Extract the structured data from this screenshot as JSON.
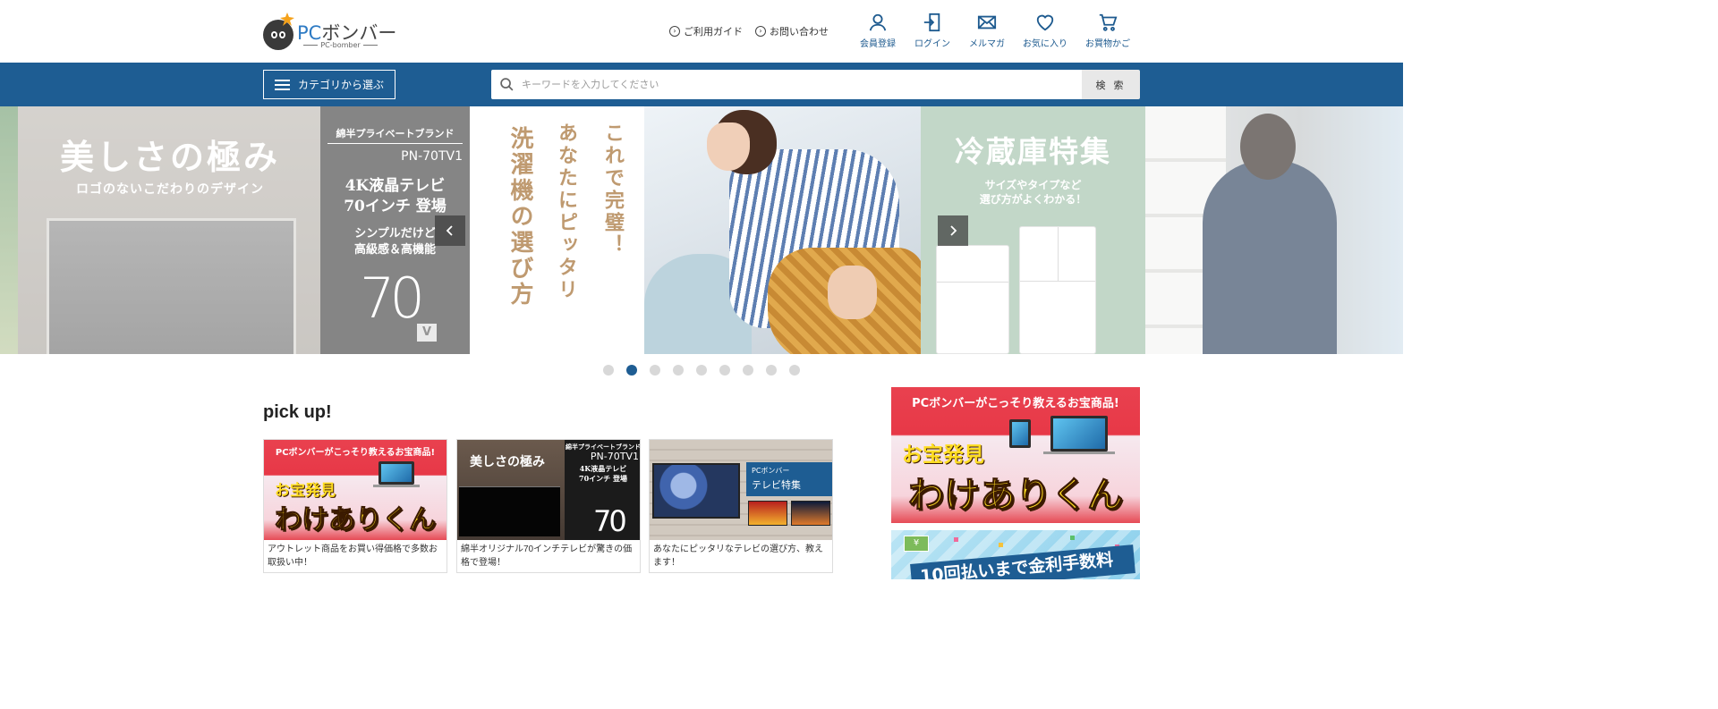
{
  "header": {
    "logo": {
      "main_prefix": "PC",
      "main_rest": "ボンバー",
      "sub": "PC-bomber"
    },
    "guide_link": "ご利用ガイド",
    "contact_link": "お問い合わせ",
    "utility": [
      {
        "label": "会員登録",
        "icon": "user-icon"
      },
      {
        "label": "ログイン",
        "icon": "login-icon"
      },
      {
        "label": "メルマガ",
        "icon": "mail-icon"
      },
      {
        "label": "お気に入り",
        "icon": "heart-icon"
      },
      {
        "label": "お買物かご",
        "icon": "cart-icon"
      }
    ]
  },
  "navbar": {
    "category_button": "カテゴリから選ぶ",
    "search_placeholder": "キーワードを入力してください",
    "search_value": "",
    "search_button": "検 索"
  },
  "carousel": {
    "tv_slide": {
      "title": "美しさの極み",
      "subtitle": "ロゴのないこだわりのデザイン",
      "brand": "綿半プライベートブランド",
      "model": "PN-70TV1",
      "spec_line1": "4K液晶テレビ",
      "spec_line2": "70インチ 登場",
      "feature_line1": "シンプルだけど",
      "feature_line2": "高級感＆高機能",
      "size_number": "70",
      "size_unit": "V"
    },
    "wash_slide": {
      "col1": "これで完璧！",
      "col2": "あなたにピッタリ",
      "col3": "洗濯機の選び方"
    },
    "fridge_slide": {
      "title": "冷蔵庫特集",
      "sub_line1": "サイズやタイプなど",
      "sub_line2": "選び方がよくわかる！"
    },
    "total_slides": 9,
    "active_slide": 2,
    "colors": {
      "accent": "#1e5d93",
      "dot_inactive": "#d8d8d8"
    }
  },
  "pickup": {
    "title": "pick up!",
    "cards": [
      {
        "banner_top": "PCボンバーがこっそり教えるお宝商品!",
        "banner_small": "お宝発見",
        "banner_main": "わけありくん",
        "caption": "アウトレット商品をお買い得価格で多数お取扱い中！"
      },
      {
        "title": "美しさの極み",
        "brand": "綿半プライベートブランド",
        "model": "PN-70TV1",
        "spec_line1": "4K液晶テレビ",
        "spec_line2": "70インチ 登場",
        "size_number": "70",
        "caption": "綿半オリジナル70インチテレビが驚きの価格で登場！"
      },
      {
        "label_small": "PCボンバー",
        "label_main": "テレビ特集",
        "caption": "あなたにピッタリなテレビの選び方、教えます！"
      }
    ]
  },
  "side": {
    "banner1": {
      "top": "PCボンバーがこっそり教えるお宝商品!",
      "small": "お宝発見",
      "main": "わけありくん"
    },
    "banner2": {
      "card": "¥",
      "text": "10回払いまで金利手数料"
    }
  }
}
